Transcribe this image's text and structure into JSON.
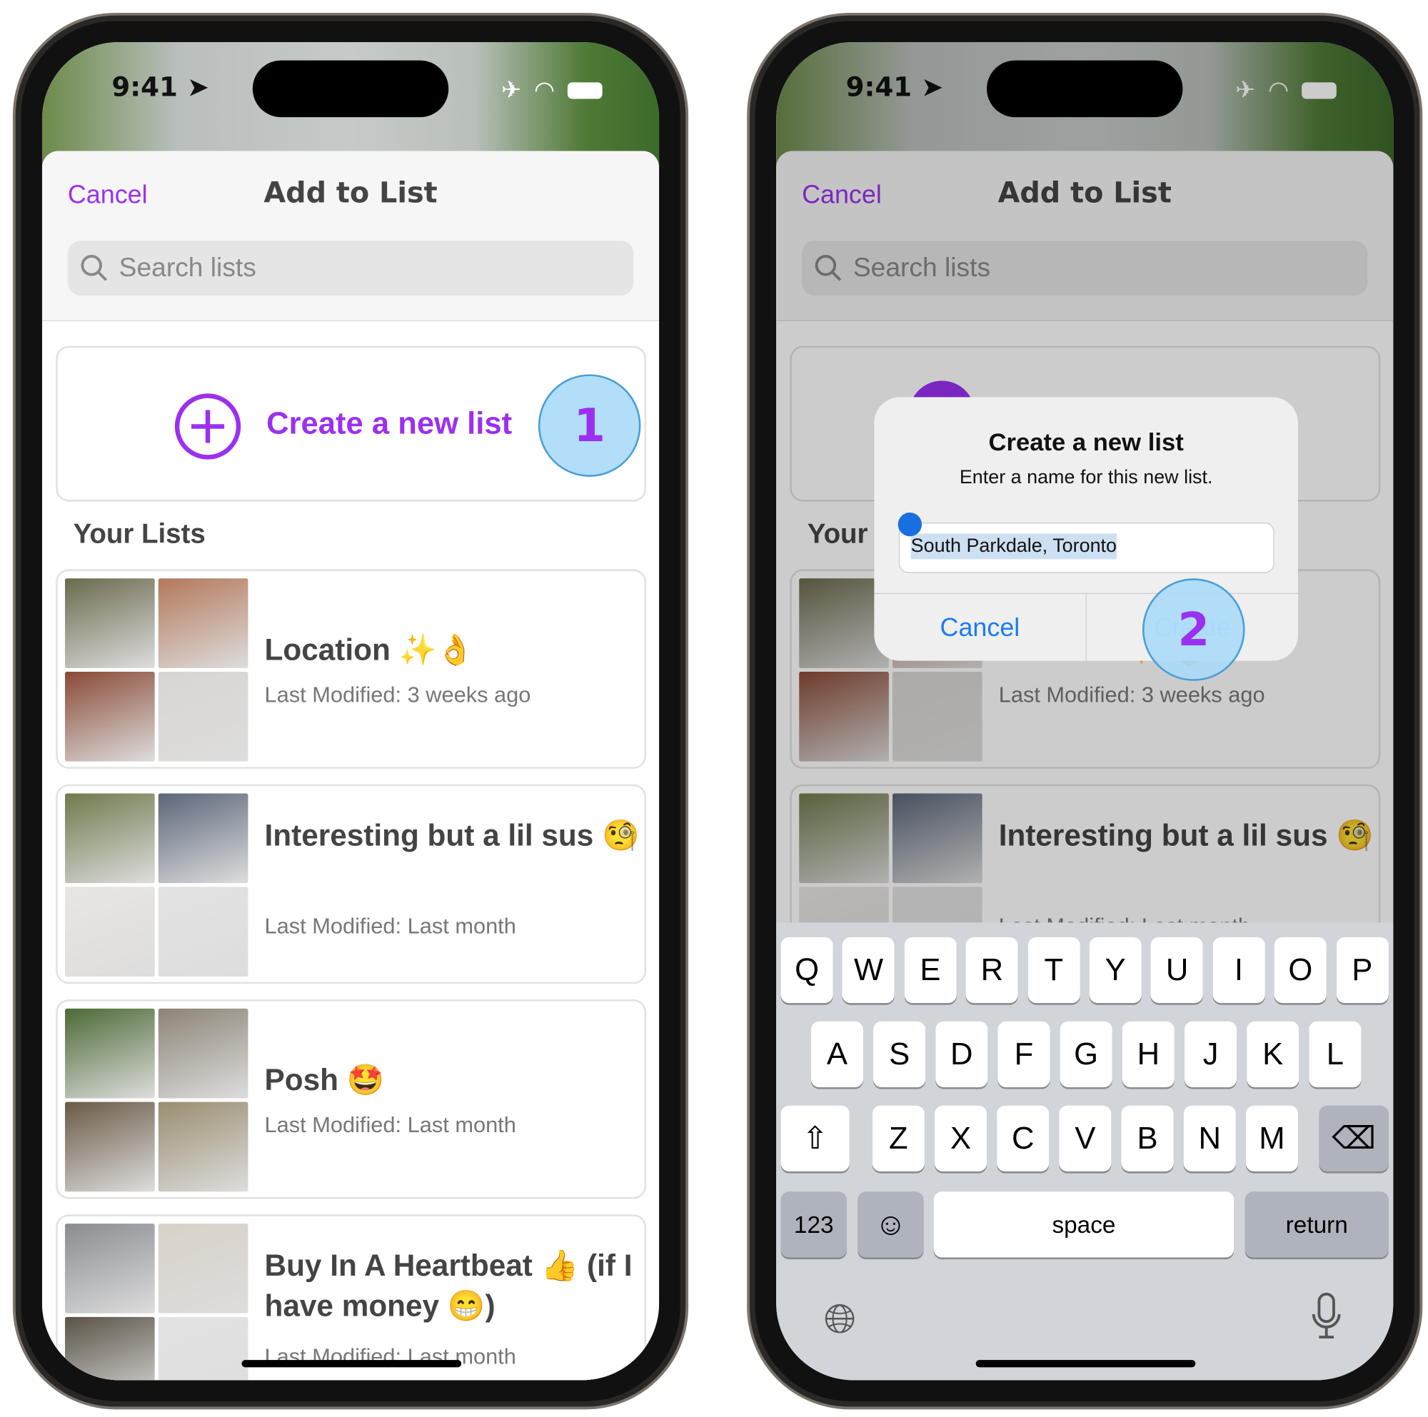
{
  "accent_color": "#9b30f0",
  "ios_blue": "#1a7cf5",
  "status": {
    "time": "9:41",
    "icons": [
      "location-arrow-icon",
      "airplane-icon",
      "wifi-icon",
      "battery-icon"
    ]
  },
  "left": {
    "header": {
      "cancel": "Cancel",
      "title": "Add to List"
    },
    "search": {
      "placeholder": "Search lists"
    },
    "create": {
      "label": "Create a new list"
    },
    "tap_marker": "1",
    "section_title": "Your Lists",
    "lists": [
      {
        "title": "Location ✨👌",
        "subtitle": "Last Modified: 3 weeks ago"
      },
      {
        "title": "Interesting but a lil sus 🧐",
        "subtitle": "Last Modified: Last month"
      },
      {
        "title": "Posh 🤩",
        "subtitle": "Last Modified: Last month"
      },
      {
        "title": "Buy In A Heartbeat 👍 (if I have money 😁)",
        "subtitle": "Last Modified: Last month"
      }
    ]
  },
  "right": {
    "header": {
      "cancel": "Cancel",
      "title": "Add to List"
    },
    "search": {
      "placeholder": "Search lists"
    },
    "section_title": "Your",
    "lists": [
      {
        "title": "Location ✨👌",
        "subtitle": "Last Modified: 3 weeks ago"
      },
      {
        "title": "Interesting but a lil sus 🧐",
        "subtitle": "Last Modified: Last month"
      }
    ],
    "dialog": {
      "title": "Create a new list",
      "message": "Enter a name for this new list.",
      "value": "South Parkdale, Toronto",
      "cancel": "Cancel",
      "create": "Create"
    },
    "tap_marker": "2",
    "keyboard": {
      "row1": [
        "Q",
        "W",
        "E",
        "R",
        "T",
        "Y",
        "U",
        "I",
        "O",
        "P"
      ],
      "row2": [
        "A",
        "S",
        "D",
        "F",
        "G",
        "H",
        "J",
        "K",
        "L"
      ],
      "row3": [
        "Z",
        "X",
        "C",
        "V",
        "B",
        "N",
        "M"
      ],
      "numbers": "123",
      "space": "space",
      "return": "return"
    }
  }
}
